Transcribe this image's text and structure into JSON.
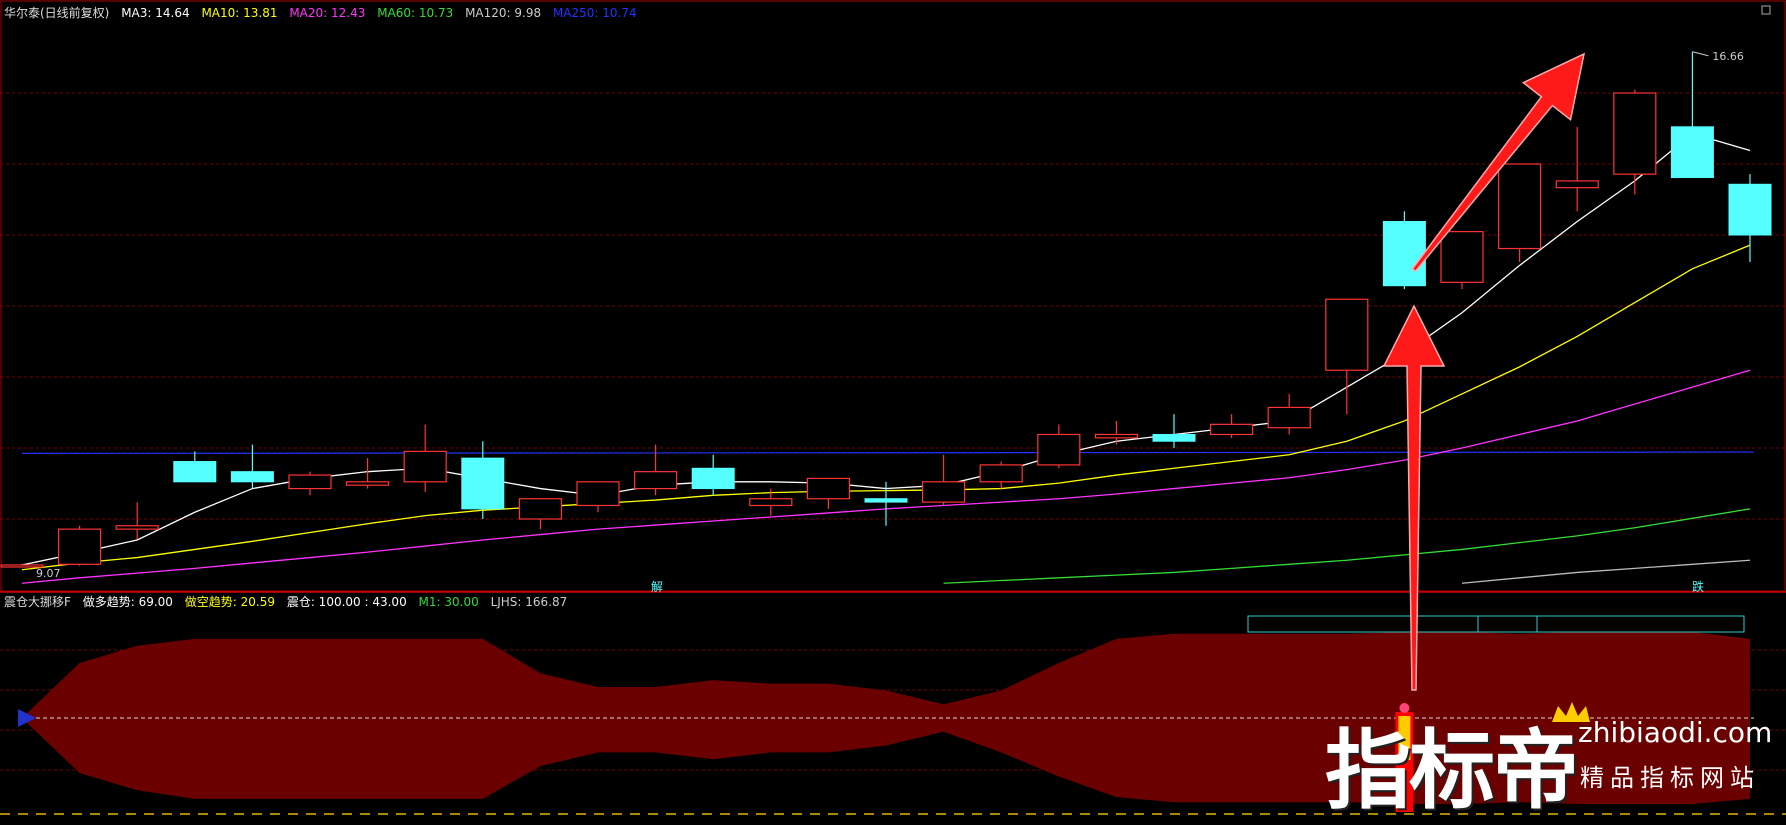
{
  "main_panel": {
    "stock_title": "华尔泰(日线前复权)",
    "legend": [
      {
        "label": "MA3: 14.64",
        "color": "#ffffff"
      },
      {
        "label": "MA10: 13.81",
        "color": "#ffff00"
      },
      {
        "label": "MA20: 12.43",
        "color": "#ff33ff"
      },
      {
        "label": "MA60: 10.73",
        "color": "#33dd33"
      },
      {
        "label": "MA120: 9.98",
        "color": "#cccccc"
      },
      {
        "label": "MA250: 10.74",
        "color": "#2233ff"
      }
    ],
    "price_high_label": "16.66",
    "price_low_label": "9.07",
    "signal_labels": [
      {
        "text": "解",
        "index": 11
      },
      {
        "text": "跌",
        "index": 29
      }
    ]
  },
  "sub_panel": {
    "indicator_name": "震仓大挪移F",
    "legend": [
      {
        "label": "做多趋势: 69.00",
        "color": "#ffffff"
      },
      {
        "label": "做空趋势: 20.59",
        "color": "#ffff00"
      },
      {
        "label": "震仓: 100.00 : 43.00",
        "color": "#ffffff"
      },
      {
        "label": "M1: 30.00",
        "color": "#33dd33"
      },
      {
        "label": "LJHS: 166.87",
        "color": "#cccccc"
      }
    ]
  },
  "watermark": {
    "brand": "指标帝",
    "site": "zhibiaodi.com",
    "tagline": "精品指标网站"
  },
  "colors": {
    "up": "#ff3333",
    "down": "#55ffff",
    "grid": "#7a0000",
    "band": "#6a0000",
    "arrow": "#ff1a1a"
  },
  "chart_data": {
    "type": "candlestick",
    "title": "华尔泰(日线前复权)",
    "ylim": [
      8.7,
      17.1
    ],
    "candles": [
      {
        "o": 9.07,
        "h": 9.09,
        "l": 9.05,
        "c": 9.07
      },
      {
        "o": 9.08,
        "h": 9.65,
        "l": 9.06,
        "c": 9.6
      },
      {
        "o": 9.6,
        "h": 10.0,
        "l": 9.45,
        "c": 9.65
      },
      {
        "o": 10.6,
        "h": 10.75,
        "l": 10.3,
        "c": 10.3
      },
      {
        "o": 10.45,
        "h": 10.85,
        "l": 10.2,
        "c": 10.3
      },
      {
        "o": 10.2,
        "h": 10.45,
        "l": 10.1,
        "c": 10.4
      },
      {
        "o": 10.25,
        "h": 10.65,
        "l": 10.2,
        "c": 10.3
      },
      {
        "o": 10.3,
        "h": 11.15,
        "l": 10.15,
        "c": 10.75
      },
      {
        "o": 10.65,
        "h": 10.9,
        "l": 9.75,
        "c": 9.9
      },
      {
        "o": 9.75,
        "h": 10.05,
        "l": 9.6,
        "c": 10.05
      },
      {
        "o": 9.95,
        "h": 10.3,
        "l": 9.85,
        "c": 10.3
      },
      {
        "o": 10.2,
        "h": 10.85,
        "l": 10.1,
        "c": 10.45
      },
      {
        "o": 10.5,
        "h": 10.7,
        "l": 10.1,
        "c": 10.2
      },
      {
        "o": 9.95,
        "h": 10.2,
        "l": 9.8,
        "c": 10.05
      },
      {
        "o": 10.05,
        "h": 10.3,
        "l": 9.9,
        "c": 10.35
      },
      {
        "o": 10.05,
        "h": 10.3,
        "l": 9.65,
        "c": 10.0
      },
      {
        "o": 10.0,
        "h": 10.7,
        "l": 9.95,
        "c": 10.3
      },
      {
        "o": 10.3,
        "h": 10.6,
        "l": 10.2,
        "c": 10.55
      },
      {
        "o": 10.55,
        "h": 11.15,
        "l": 10.5,
        "c": 11.0
      },
      {
        "o": 10.95,
        "h": 11.2,
        "l": 10.85,
        "c": 11.0
      },
      {
        "o": 11.0,
        "h": 11.3,
        "l": 10.8,
        "c": 10.9
      },
      {
        "o": 11.0,
        "h": 11.3,
        "l": 10.95,
        "c": 11.15
      },
      {
        "o": 11.1,
        "h": 11.6,
        "l": 11.0,
        "c": 11.4
      },
      {
        "o": 11.95,
        "h": 12.45,
        "l": 11.3,
        "c": 13.0
      },
      {
        "o": 14.15,
        "h": 14.3,
        "l": 13.15,
        "c": 13.2
      },
      {
        "o": 13.25,
        "h": 13.35,
        "l": 13.15,
        "c": 14.0
      },
      {
        "o": 13.75,
        "h": 15.0,
        "l": 13.55,
        "c": 15.0
      },
      {
        "o": 14.65,
        "h": 15.55,
        "l": 14.3,
        "c": 14.75
      },
      {
        "o": 14.85,
        "h": 16.1,
        "l": 14.55,
        "c": 16.05
      },
      {
        "o": 15.55,
        "h": 16.66,
        "l": 14.8,
        "c": 14.8
      },
      {
        "o": 14.7,
        "h": 14.85,
        "l": 13.55,
        "c": 13.95
      }
    ],
    "ma3": [
      9.07,
      9.25,
      9.44,
      9.85,
      10.2,
      10.35,
      10.45,
      10.5,
      10.35,
      10.2,
      10.1,
      10.25,
      10.3,
      10.3,
      10.28,
      10.2,
      10.25,
      10.45,
      10.7,
      10.9,
      11.0,
      11.1,
      11.2,
      11.7,
      12.2,
      12.8,
      13.5,
      14.15,
      14.75,
      15.45,
      15.2
    ],
    "ma10": [
      9.0,
      9.1,
      9.18,
      9.3,
      9.42,
      9.55,
      9.68,
      9.8,
      9.88,
      9.93,
      9.98,
      10.03,
      10.1,
      10.14,
      10.16,
      10.17,
      10.18,
      10.2,
      10.28,
      10.4,
      10.5,
      10.6,
      10.7,
      10.9,
      11.2,
      11.6,
      12.0,
      12.45,
      12.95,
      13.45,
      13.8
    ],
    "ma20": [
      8.8,
      8.88,
      8.95,
      9.02,
      9.1,
      9.18,
      9.26,
      9.35,
      9.44,
      9.52,
      9.6,
      9.66,
      9.72,
      9.78,
      9.84,
      9.9,
      9.95,
      10.0,
      10.05,
      10.12,
      10.2,
      10.28,
      10.36,
      10.48,
      10.62,
      10.8,
      11.0,
      11.2,
      11.45,
      11.7,
      11.95
    ],
    "ma60_start_index": 16,
    "ma60": [
      8.8,
      8.84,
      8.88,
      8.92,
      8.96,
      9.02,
      9.08,
      9.14,
      9.22,
      9.3,
      9.4,
      9.5,
      9.62,
      9.76,
      9.9
    ],
    "ma120_start_index": 25,
    "ma120": [
      8.8,
      8.88,
      8.96,
      9.02,
      9.08,
      9.14
    ]
  },
  "sub_chart_data": {
    "type": "area",
    "ylim": [
      0,
      100
    ],
    "upper": [
      50,
      82,
      92,
      96,
      96,
      96,
      96,
      96,
      96,
      76,
      68,
      68,
      72,
      70,
      70,
      66,
      58,
      66,
      82,
      96,
      99,
      99,
      99,
      99,
      100,
      100,
      99,
      100,
      100,
      100,
      96
    ],
    "lower": [
      50,
      18,
      8,
      3,
      3,
      3,
      3,
      3,
      3,
      22,
      30,
      30,
      26,
      30,
      30,
      34,
      42,
      30,
      16,
      4,
      1,
      1,
      1,
      1,
      0,
      0,
      1,
      0,
      0,
      0,
      3
    ],
    "signal_index": 24
  }
}
